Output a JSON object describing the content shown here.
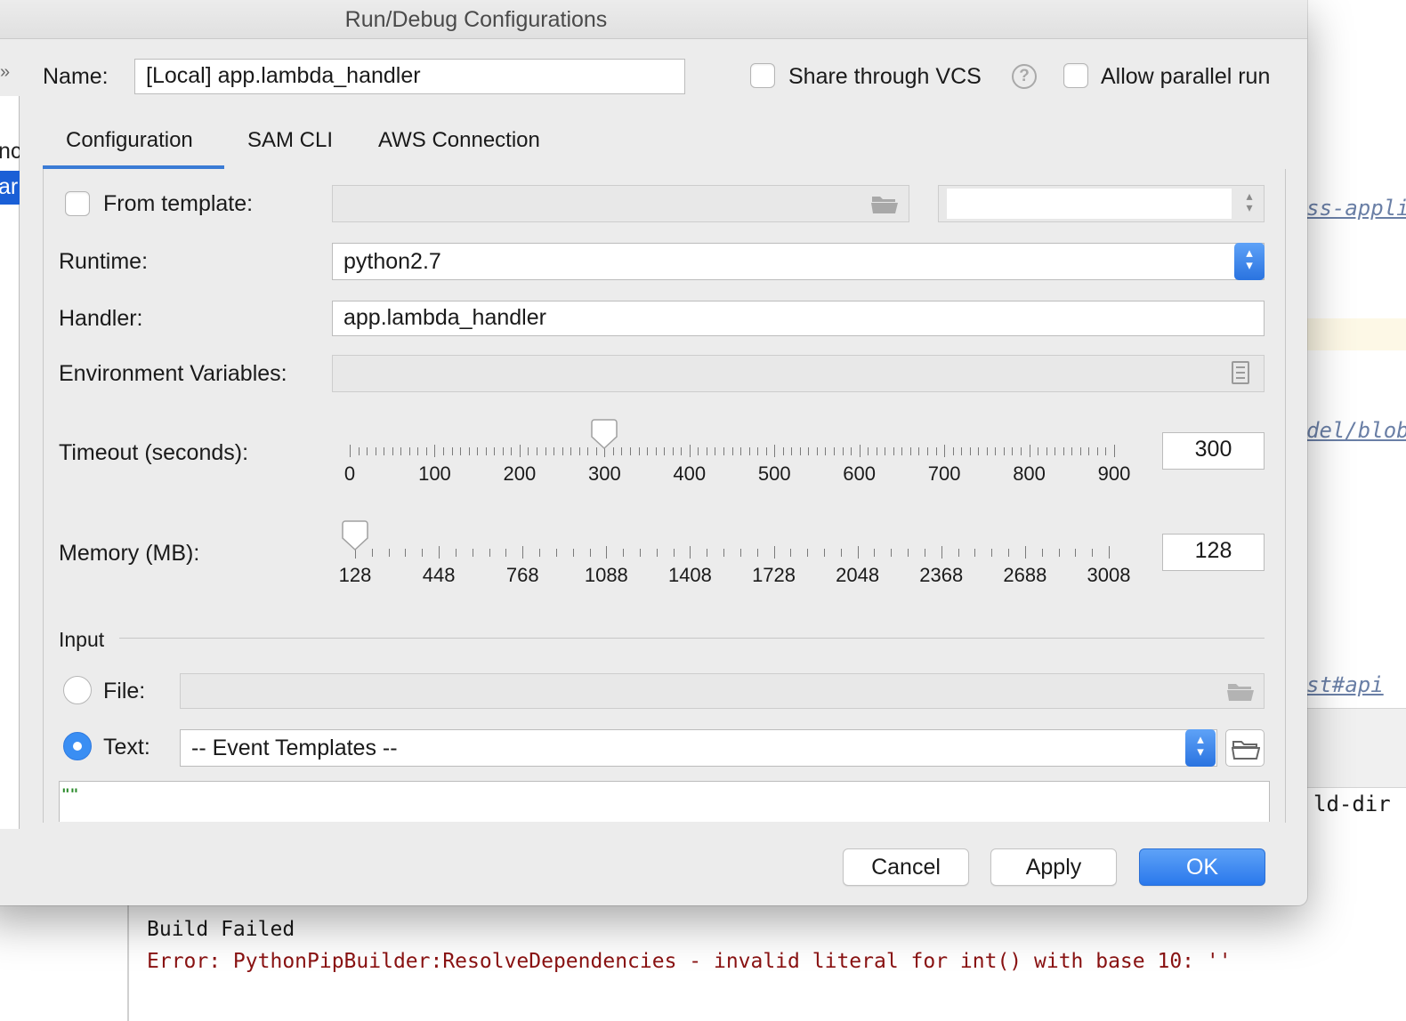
{
  "background": {
    "links": [
      "ss-appli",
      "del/blob",
      "st#api"
    ],
    "code_fragment": "ld-dir",
    "console": {
      "line1": "Build Failed",
      "line2": "Error: PythonPipBuilder:ResolveDependencies - invalid literal for int() with base 10: ''"
    }
  },
  "dialog": {
    "title": "Run/Debug Configurations",
    "left_tree": {
      "chevron": "»",
      "item1": "nc",
      "item2": "ar"
    },
    "name_label": "Name:",
    "name_value": "[Local] app.lambda_handler",
    "share_vcs_label": "Share through VCS",
    "help_glyph": "?",
    "allow_parallel_label": "Allow parallel run",
    "tabs": [
      "Configuration",
      "SAM CLI",
      "AWS Connection"
    ],
    "active_tab": "Configuration",
    "from_template_label": "From template:",
    "runtime_label": "Runtime:",
    "runtime_value": "python2.7",
    "handler_label": "Handler:",
    "handler_value": "app.lambda_handler",
    "env_vars_label": "Environment Variables:",
    "timeout": {
      "label": "Timeout (seconds):",
      "ticks": [
        "0",
        "100",
        "200",
        "300",
        "400",
        "500",
        "600",
        "700",
        "800",
        "900"
      ],
      "value": "300"
    },
    "memory": {
      "label": "Memory (MB):",
      "ticks": [
        "128",
        "448",
        "768",
        "1088",
        "1408",
        "1728",
        "2048",
        "2368",
        "2688",
        "3008"
      ],
      "value": "128"
    },
    "input_section_label": "Input",
    "file_label": "File:",
    "text_label": "Text:",
    "event_templates_value": "-- Event Templates --",
    "editor_content": "\"\"",
    "buttons": {
      "cancel": "Cancel",
      "apply": "Apply",
      "ok": "OK"
    }
  },
  "colors": {
    "accent": "#3a7bd5",
    "primary_button": "#2a78ec",
    "error_text": "#8a1212",
    "link_text": "#6a7fa6"
  }
}
